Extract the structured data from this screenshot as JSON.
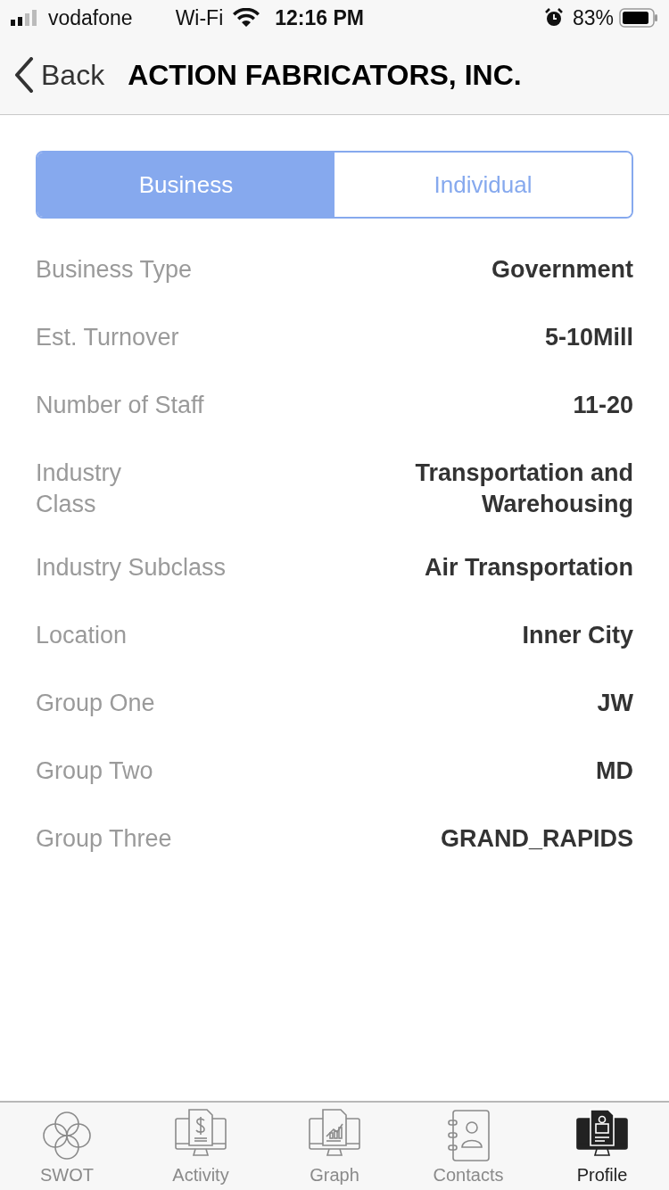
{
  "status_bar": {
    "carrier": "vodafone",
    "network": "Wi-Fi",
    "time": "12:16 PM",
    "battery": "83%"
  },
  "nav_bar": {
    "back": "Back",
    "title": "ACTION FABRICATORS, INC."
  },
  "segments": [
    {
      "label": "Business",
      "selected": true
    },
    {
      "label": "Individual",
      "selected": false
    }
  ],
  "fields": [
    {
      "label": "Business Type",
      "value": "Government"
    },
    {
      "label": "Est. Turnover",
      "value": "5-10Mill"
    },
    {
      "label": "Number of Staff",
      "value": "11-20"
    },
    {
      "label": "Industry\nClass",
      "value": "Transportation and\nWarehousing"
    },
    {
      "label": "Industry Subclass",
      "value": "Air Transportation"
    },
    {
      "label": "Location",
      "value": "Inner City"
    },
    {
      "label": "Group One",
      "value": "JW"
    },
    {
      "label": "Group Two",
      "value": "MD"
    },
    {
      "label": "Group Three",
      "value": "GRAND_RAPIDS"
    }
  ],
  "tab_bar": [
    {
      "kind": "swot",
      "label": "SWOT",
      "selected": false
    },
    {
      "kind": "activity",
      "label": "Activity",
      "selected": false
    },
    {
      "kind": "graph",
      "label": "Graph",
      "selected": false
    },
    {
      "kind": "contacts",
      "label": "Contacts",
      "selected": false
    },
    {
      "kind": "profile",
      "label": "Profile",
      "selected": true
    }
  ]
}
